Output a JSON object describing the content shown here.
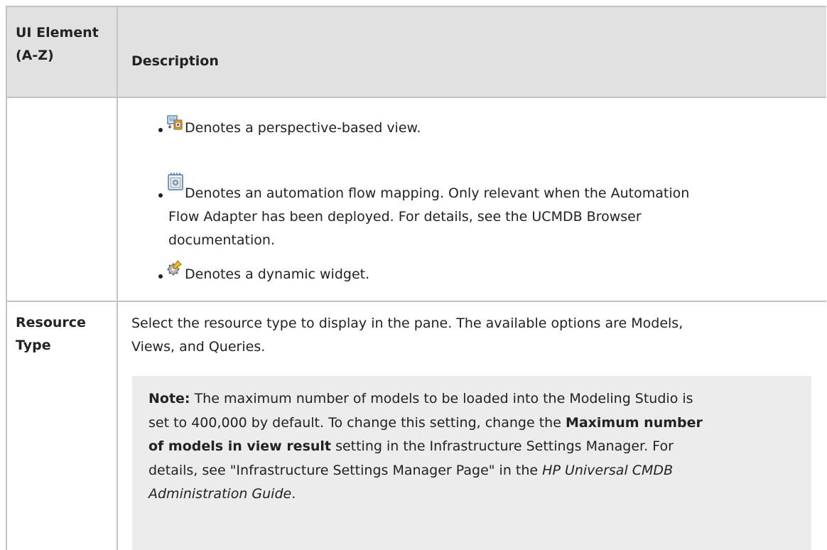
{
  "table": {
    "header": {
      "col1_line1": "UI Element",
      "col1_line2": "(A-Z)",
      "col2": "Description"
    },
    "row1": {
      "bullets": [
        {
          "icon": "perspective-view-icon",
          "text": "Denotes a perspective-based view."
        },
        {
          "icon": "automation-flow-mapping-icon",
          "text_line1": "Denotes an automation flow mapping. Only relevant when the Automation",
          "text_line2": "Flow Adapter has been deployed. For details, see the UCMDB Browser",
          "text_line3": "documentation."
        },
        {
          "icon": "dynamic-widget-icon",
          "text": "Denotes a dynamic widget."
        }
      ]
    },
    "row2": {
      "element_line1": "Resource",
      "element_line2": "Type",
      "desc_line1": "Select the resource type to display in the pane. The available options are Models,",
      "desc_line2": "Views, and Queries.",
      "note": {
        "label": "Note:",
        "l1": "The maximum number of models to be loaded into the Modeling Studio is",
        "l2_pre": "set to 400,000 by default. To change this setting, change the",
        "l2_bold": "Maximum number",
        "l3_bold": "of models in view result",
        "l3_post": "setting in the Infrastructure Settings Manager. For",
        "l4_pre": "details, see \"Infrastructure Settings Manager Page\" in the",
        "l4_italic": "HP Universal CMDB",
        "l5_italic": "Administration Guide",
        "l5_post": "."
      }
    }
  },
  "colors": {
    "header_bg": "#e1e1e1",
    "note_bg": "#ececec",
    "border": "#c3c3c3",
    "text": "#222222"
  }
}
